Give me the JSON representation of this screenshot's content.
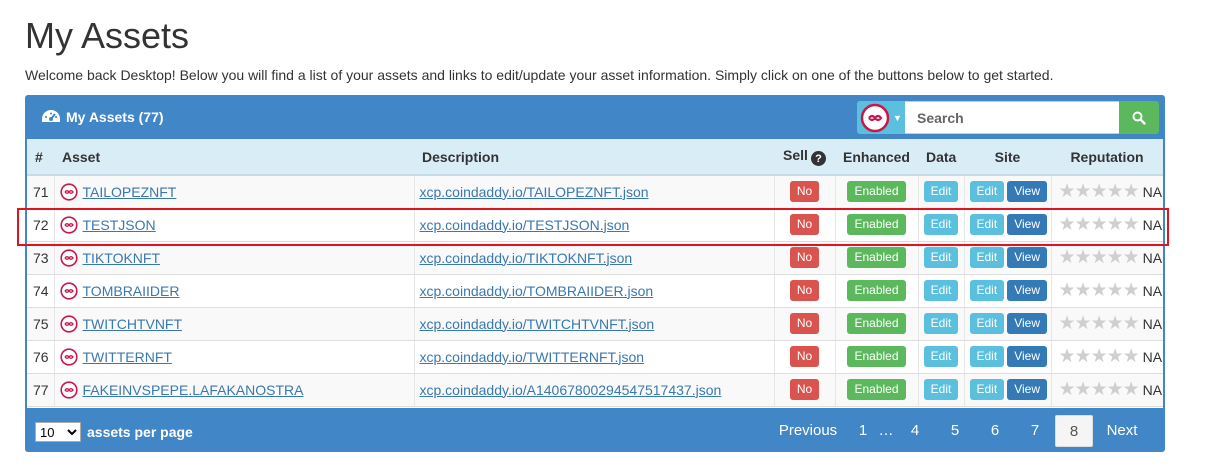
{
  "page": {
    "title": "My Assets",
    "welcome": "Welcome back Desktop! Below you will find a list of your assets and links to edit/update your asset information. Simply click on one of the buttons below to get started."
  },
  "panel": {
    "title": "My Assets (77)",
    "search_placeholder": "Search"
  },
  "columns": {
    "num": "#",
    "asset": "Asset",
    "description": "Description",
    "sell": "Sell",
    "enhanced": "Enhanced",
    "data": "Data",
    "site": "Site",
    "reputation": "Reputation"
  },
  "labels": {
    "no": "No",
    "enabled": "Enabled",
    "edit": "Edit",
    "view": "View",
    "na": "NA"
  },
  "rows": [
    {
      "num": "71",
      "asset": "TAILOPEZNFT",
      "desc": "xcp.coindaddy.io/TAILOPEZNFT.json"
    },
    {
      "num": "72",
      "asset": "TESTJSON",
      "desc": "xcp.coindaddy.io/TESTJSON.json"
    },
    {
      "num": "73",
      "asset": "TIKTOKNFT",
      "desc": "xcp.coindaddy.io/TIKTOKNFT.json"
    },
    {
      "num": "74",
      "asset": "TOMBRAIIDER",
      "desc": "xcp.coindaddy.io/TOMBRAIIDER.json"
    },
    {
      "num": "75",
      "asset": "TWITCHTVNFT",
      "desc": "xcp.coindaddy.io/TWITCHTVNFT.json"
    },
    {
      "num": "76",
      "asset": "TWITTERNFT",
      "desc": "xcp.coindaddy.io/TWITTERNFT.json"
    },
    {
      "num": "77",
      "asset": "FAKEINVSPEPE.LAFAKANOSTRA",
      "desc": "xcp.coindaddy.io/A14067800294547517437.json"
    }
  ],
  "footer": {
    "per_page_value": "10",
    "per_page_label": "assets per page",
    "pagination": {
      "previous": "Previous",
      "pages": [
        "1",
        "…",
        "4",
        "5",
        "6",
        "7",
        "8"
      ],
      "active": "8",
      "next": "Next"
    }
  },
  "colors": {
    "panel": "#4186c6",
    "header_row": "#d9edf7",
    "no": "#d9534f",
    "enabled": "#5cb85c",
    "edit": "#5bc0de",
    "view": "#337ab7",
    "highlight": "#e0141e"
  }
}
